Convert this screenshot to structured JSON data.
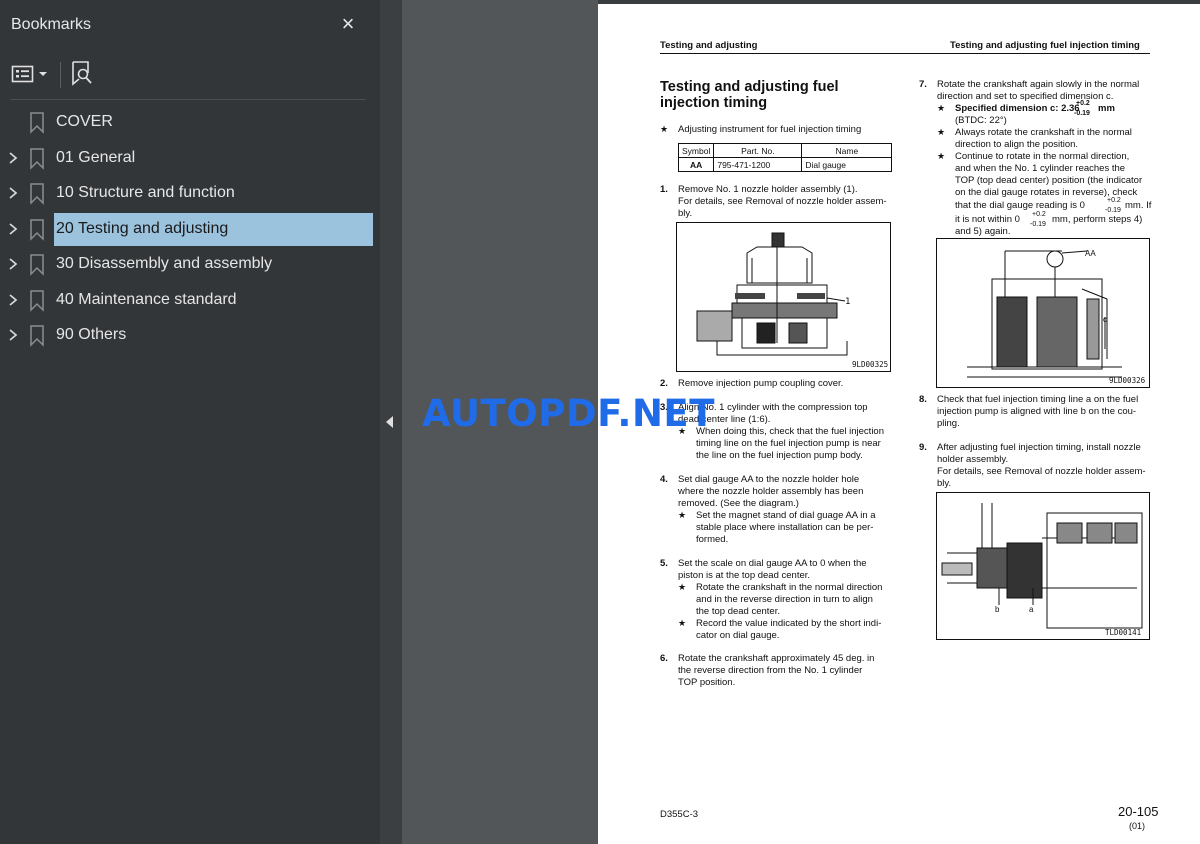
{
  "sidebar": {
    "title": "Bookmarks",
    "close_icon": "×",
    "items": [
      {
        "label": "COVER",
        "expandable": false,
        "selected": false
      },
      {
        "label": "01 General",
        "expandable": true,
        "selected": false
      },
      {
        "label": "10 Structure and function",
        "expandable": true,
        "selected": false
      },
      {
        "label": "20 Testing and adjusting",
        "expandable": true,
        "selected": true
      },
      {
        "label": "30 Disassembly and assembly",
        "expandable": true,
        "selected": false
      },
      {
        "label": "40 Maintenance standard",
        "expandable": true,
        "selected": false
      },
      {
        "label": "90 Others",
        "expandable": true,
        "selected": false
      }
    ]
  },
  "watermark": "AUTOPDF.NET",
  "page": {
    "header_left": "Testing and adjusting",
    "header_right": "Testing and adjusting fuel injection timing",
    "section_title": "Testing and adjusting fuel injection timing",
    "intro_star": "Adjusting instrument for fuel injection timing",
    "tool_table": {
      "headers": [
        "Symbol",
        "Part. No.",
        "Name"
      ],
      "row": [
        "AA",
        "795-471-1200",
        "Dial gauge"
      ]
    },
    "steps": {
      "s1_num": "1.",
      "s1_line1": "Remove No. 1 nozzle holder assembly (1).",
      "s1_line2": "For details, see Removal of nozzle holder assem-",
      "s1_line3": "bly.",
      "fig1_callout": "1",
      "fig1_code": "9LD00325",
      "s2_num": "2.",
      "s2_line1": "Remove injection pump coupling cover.",
      "s3_num": "3.",
      "s3_line1": "Align No. 1 cylinder with the compression top",
      "s3_line2": "dead center line (1:6).",
      "s3_star1": "When doing this, check that the fuel injection",
      "s3_star2": "timing line on the fuel injection pump is near",
      "s3_star3": "the line on the fuel injection pump body.",
      "s4_num": "4.",
      "s4_line1": "Set dial gauge AA to the nozzle holder hole",
      "s4_line2": "where the nozzle holder assembly has been",
      "s4_line3": "removed. (See the diagram.)",
      "s4_star1": "Set the  magnet stand of dial guage AA in a",
      "s4_star2": "stable place where installation can be per-",
      "s4_star3": "formed.",
      "s5_num": "5.",
      "s5_line1": "Set the scale on dial gauge AA to 0 when the",
      "s5_line2": "piston is at the top dead center.",
      "s5_star1a": "Rotate the crankshaft in the normal direction",
      "s5_star1b": "and in the reverse direction in turn to align",
      "s5_star1c": "the top dead center.",
      "s5_star2a": "Record the value indicated by the short indi-",
      "s5_star2b": "cator on dial gauge.",
      "s6_num": "6.",
      "s6_line1": "Rotate the crankshaft approximately 45 deg. in",
      "s6_line2": "the reverse direction from the No. 1 cylinder",
      "s6_line3": "TOP position.",
      "s7_num": "7.",
      "s7_line1": "Rotate the crankshaft again slowly in the normal",
      "s7_line2": "direction and set to specified dimension c.",
      "s7_spec": "Specified dimension c: 2.36",
      "s7_spec_plus": "+0.2",
      "s7_spec_minus": "-0.19",
      "s7_spec_unit": "mm",
      "s7_btdc": "(BTDC: 22°)",
      "s7_star2a": "Always rotate the crankshaft in the normal",
      "s7_star2b": "direction to align the position.",
      "s7_star3a": "Continue to rotate in the normal direction,",
      "s7_star3b": "and when the No. 1 cylinder reaches the",
      "s7_star3c": "TOP (top dead center) position (the indicator",
      "s7_star3d": "on the dial gauge rotates in reverse), check",
      "s7_star3e": "that the dial gauge reading is 0",
      "s7_star3e_plus": "+0.2",
      "s7_star3e_minus": "-0.19",
      "s7_star3e_end": "mm. If",
      "s7_star3f": "it is not within 0",
      "s7_star3f_plus": "+0.2",
      "s7_star3f_minus": "-0.19",
      "s7_star3f_end": "mm, perform steps 4)",
      "s7_star3g": "and 5) again.",
      "fig2_aa": "AA",
      "fig2_c": "c",
      "fig2_code": "9LD00326",
      "s8_num": "8.",
      "s8_line1": "Check that fuel injection timing line a on the fuel",
      "s8_line2": "injection pump is aligned with line b on the cou-",
      "s8_line3": "pling.",
      "s9_num": "9.",
      "s9_line1": "After adjusting fuel injection timing, install nozzle",
      "s9_line2": "holder assembly.",
      "s9_line3": "For details, see Removal of nozzle holder assem-",
      "s9_line4": "bly.",
      "fig3_b": "b",
      "fig3_a": "a",
      "fig3_code": "TLD00141"
    },
    "footer_left": "D355C-3",
    "footer_page": "20-105",
    "footer_sub": "(01)"
  }
}
